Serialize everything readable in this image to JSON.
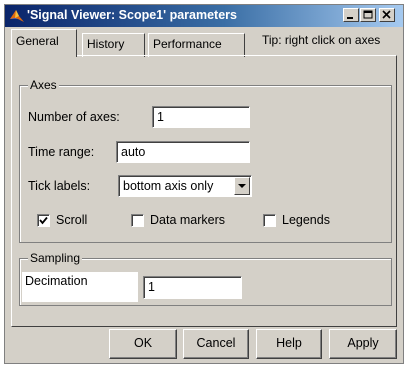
{
  "window": {
    "title": "'Signal Viewer: Scope1' parameters",
    "title_buttons": [
      "minimize",
      "maximize",
      "close"
    ]
  },
  "tabs": [
    {
      "label": "General",
      "active": true
    },
    {
      "label": "History",
      "active": false
    },
    {
      "label": "Performance",
      "active": false
    }
  ],
  "tip": "Tip: right click on axes",
  "axes_group": {
    "legend": "Axes",
    "number_of_axes_label": "Number of axes:",
    "number_of_axes_value": "1",
    "time_range_label": "Time range:",
    "time_range_value": "auto",
    "tick_labels_label": "Tick labels:",
    "tick_labels_value": "bottom axis only",
    "scroll_label": "Scroll",
    "scroll_checked": true,
    "data_markers_label": "Data markers",
    "data_markers_checked": false,
    "legends_label": "Legends",
    "legends_checked": false
  },
  "sampling_group": {
    "legend": "Sampling",
    "decimation_label": "Decimation",
    "decimation_value": "1"
  },
  "buttons": {
    "ok": "OK",
    "cancel": "Cancel",
    "help": "Help",
    "apply": "Apply"
  },
  "colors": {
    "titlebar_start": "#0a246a",
    "titlebar_end": "#a6caf0",
    "face": "#d4d0c8"
  },
  "icons": {
    "app": "matlab-icon",
    "check": "check-icon",
    "dropdown": "dropdown-arrow-icon"
  }
}
